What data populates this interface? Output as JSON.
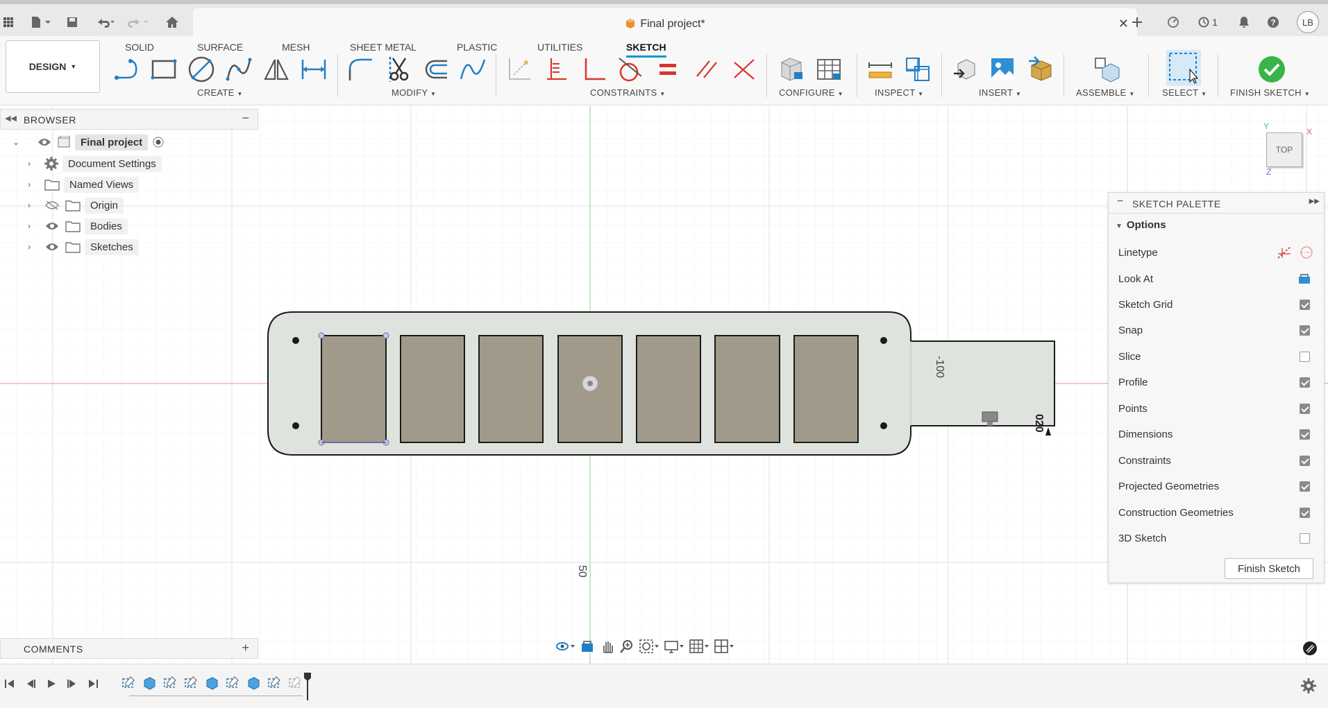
{
  "titlebar": {
    "document_title": "Final project*",
    "job_count": "1",
    "user_initials": "LB",
    "icons": [
      "app-grid-icon",
      "file-icon",
      "save-icon",
      "undo-icon",
      "redo-icon",
      "home-icon",
      "close-tab-icon",
      "new-tab-icon",
      "extensions-icon",
      "jobs-icon",
      "notifications-icon",
      "help-icon"
    ]
  },
  "toolbar": {
    "workspace": "DESIGN",
    "tabs": [
      {
        "label": "SOLID"
      },
      {
        "label": "SURFACE"
      },
      {
        "label": "MESH"
      },
      {
        "label": "SHEET METAL"
      },
      {
        "label": "PLASTIC"
      },
      {
        "label": "UTILITIES"
      },
      {
        "label": "SKETCH"
      }
    ],
    "groups": {
      "create": "CREATE",
      "modify": "MODIFY",
      "constraints": "CONSTRAINTS",
      "configure": "CONFIGURE",
      "inspect": "INSPECT",
      "insert": "INSERT",
      "assemble": "ASSEMBLE",
      "select": "SELECT",
      "finish": "FINISH SKETCH"
    }
  },
  "browser": {
    "title": "BROWSER",
    "items": [
      {
        "label": "Final project"
      },
      {
        "label": "Document Settings"
      },
      {
        "label": "Named Views"
      },
      {
        "label": "Origin"
      },
      {
        "label": "Bodies"
      },
      {
        "label": "Sketches"
      }
    ]
  },
  "comments": {
    "title": "COMMENTS"
  },
  "viewcube": {
    "face": "TOP",
    "axis_x": "X",
    "axis_y": "Y",
    "axis_z": "Z"
  },
  "canvas": {
    "dimension_horizontal": "-100",
    "dimension_vertical": "50",
    "dimension_small": "020"
  },
  "palette": {
    "title": "SKETCH PALETTE",
    "section": "Options",
    "options": [
      {
        "label": "Linetype",
        "type": "icons"
      },
      {
        "label": "Look At",
        "type": "icon"
      },
      {
        "label": "Sketch Grid",
        "checked": true
      },
      {
        "label": "Snap",
        "checked": true
      },
      {
        "label": "Slice",
        "checked": false
      },
      {
        "label": "Profile",
        "checked": true
      },
      {
        "label": "Points",
        "checked": true
      },
      {
        "label": "Dimensions",
        "checked": true
      },
      {
        "label": "Constraints",
        "checked": true
      },
      {
        "label": "Projected Geometries",
        "checked": true
      },
      {
        "label": "Construction Geometries",
        "checked": true
      },
      {
        "label": "3D Sketch",
        "checked": false
      }
    ],
    "finish_button": "Finish Sketch"
  }
}
